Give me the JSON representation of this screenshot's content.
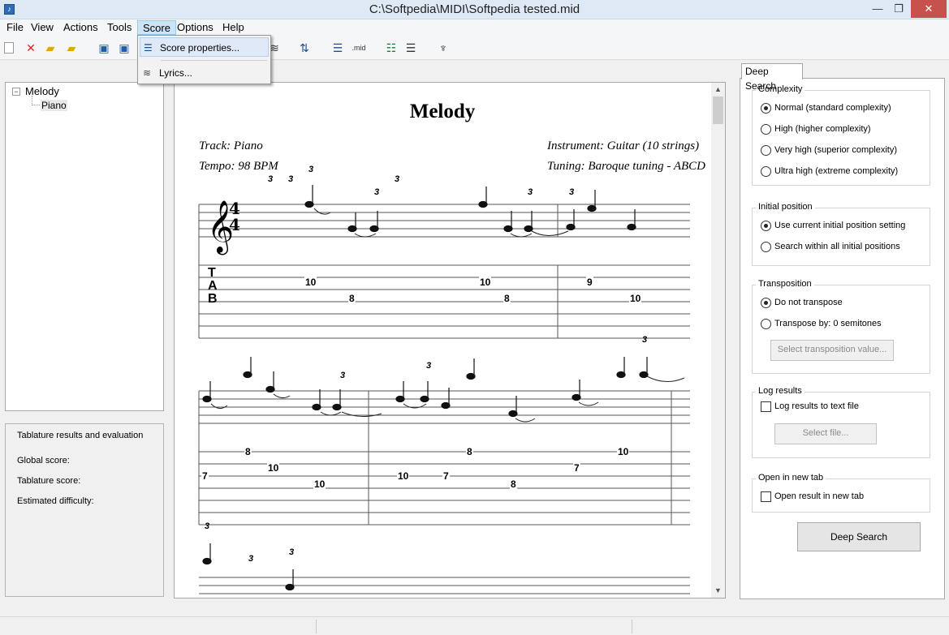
{
  "window": {
    "title": "C:\\Softpedia\\MIDI\\Softpedia tested.mid",
    "controls": [
      "—",
      "❐",
      "✕"
    ]
  },
  "menubar": [
    "File",
    "View",
    "Actions",
    "Tools",
    "Score",
    "Options",
    "Help"
  ],
  "toolbar": {
    "icons": [
      "new-file-icon",
      "close-file-icon",
      "open-folder-icon",
      "open-recent-icon",
      "save-icon",
      "save-as-icon",
      "score-view-icon",
      "transpose-icon",
      "score-export-icon",
      "midi-export-icon",
      "tab-view-icon",
      "tab-export-icon",
      "guitar-icon"
    ],
    "midi_label": ".mid"
  },
  "score_menu": {
    "items": [
      {
        "label": "Score properties...",
        "icon": "score-properties-icon"
      },
      {
        "label": "Lyrics...",
        "icon": "lyrics-icon"
      }
    ]
  },
  "tree": {
    "root": "Melody",
    "child": "Piano",
    "expander": "−"
  },
  "evaluation": {
    "title": "Tablature results and evaluation",
    "global_score": "Global score:",
    "tablature_score": "Tablature score:",
    "estimated_difficulty": "Estimated difficulty:"
  },
  "score": {
    "title": "Melody",
    "track": "Track: Piano",
    "tempo": "Tempo: 98 BPM",
    "instrument": "Instrument: Guitar (10 strings)",
    "tuning": "Tuning: Baroque tuning - ABCD",
    "tab_letters": [
      "T",
      "A",
      "B"
    ],
    "time_signature": [
      "4",
      "4"
    ],
    "triplet": "3",
    "system1_tab": [
      "10",
      "8",
      "10",
      "8",
      "9",
      "10"
    ],
    "system2_tab": [
      "8",
      "7",
      "10",
      "10",
      "10",
      "7",
      "8",
      "8",
      "7",
      "10"
    ]
  },
  "deep_search": {
    "tab_label": "Deep Search",
    "complexity": {
      "label": "Complexity",
      "options": [
        "Normal (standard complexity)",
        "High (higher complexity)",
        "Very high (superior complexity)",
        "Ultra high (extreme complexity)"
      ],
      "selected": 0
    },
    "initial_position": {
      "label": "Initial position",
      "options": [
        "Use current initial position setting",
        "Search within all initial positions"
      ],
      "selected": 0
    },
    "transposition": {
      "label": "Transposition",
      "options": [
        "Do not transpose",
        "Transpose by: 0 semitones"
      ],
      "selected": 0,
      "button": "Select transposition value..."
    },
    "log_results": {
      "label": "Log results",
      "checkbox": "Log results to text file",
      "checked": false,
      "button": "Select file..."
    },
    "open_new_tab": {
      "label": "Open in new tab",
      "checkbox": "Open result in new tab",
      "checked": false
    },
    "run_button": "Deep Search"
  }
}
